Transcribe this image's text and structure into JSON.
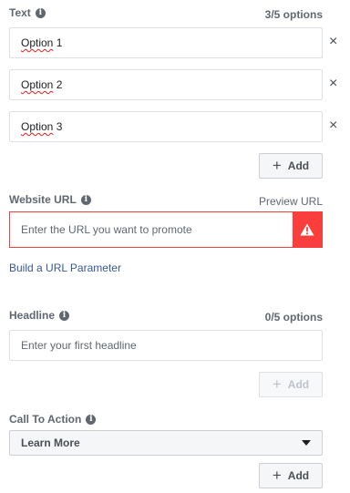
{
  "text_section": {
    "label": "Text",
    "count": "3/5 options",
    "options": [
      {
        "word": "Option",
        "number": "1"
      },
      {
        "word": "Option",
        "number": "2"
      },
      {
        "word": "Option",
        "number": "3"
      }
    ],
    "remove_icon": "×",
    "add_label": "Add"
  },
  "website_url": {
    "label": "Website URL",
    "preview_label": "Preview URL",
    "placeholder": "Enter the URL you want to promote",
    "warning_icon": "warning-icon",
    "error_color": "#fa3e3e",
    "build_param_link": "Build a URL Parameter"
  },
  "headline": {
    "label": "Headline",
    "count": "0/5 options",
    "placeholder": "Enter your first headline",
    "add_label": "Add"
  },
  "call_to_action": {
    "label": "Call To Action",
    "selected": "Learn More",
    "add_label": "Add"
  },
  "info_glyph": "i",
  "plus_glyph": "+",
  "colors": {
    "link": "#385898",
    "label": "#606770"
  }
}
